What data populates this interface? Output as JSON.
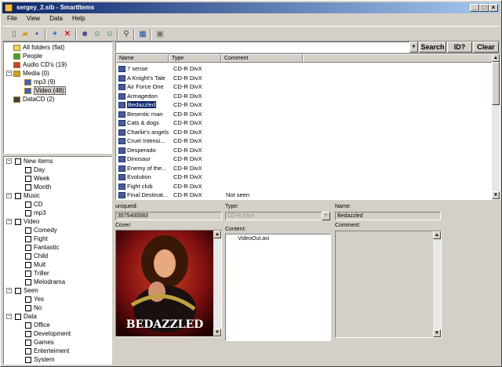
{
  "window": {
    "title": "sergey_2.sib - SmartItems"
  },
  "menu": [
    "File",
    "View",
    "Data",
    "Help"
  ],
  "folder_tree": [
    {
      "label": "All folders (flat)",
      "indent": 0
    },
    {
      "label": "People",
      "indent": 0
    },
    {
      "label": "Audio CD's  (19)",
      "indent": 0
    },
    {
      "label": "Media  (0)",
      "indent": 0
    },
    {
      "label": "mp3  (9)",
      "indent": 1
    },
    {
      "label": "Video  (48)",
      "indent": 1,
      "selected": true
    },
    {
      "label": "DataCD  (2)",
      "indent": 0
    }
  ],
  "filter_tree": [
    {
      "label": "New items",
      "indent": 0
    },
    {
      "label": "Day",
      "indent": 1
    },
    {
      "label": "Week",
      "indent": 1
    },
    {
      "label": "Month",
      "indent": 1
    },
    {
      "label": "Music",
      "indent": 0
    },
    {
      "label": "CD",
      "indent": 1
    },
    {
      "label": "mp3",
      "indent": 1
    },
    {
      "label": "Video",
      "indent": 0
    },
    {
      "label": "Comedy",
      "indent": 1
    },
    {
      "label": "Fight",
      "indent": 1
    },
    {
      "label": "Fantastic",
      "indent": 1
    },
    {
      "label": "Child",
      "indent": 1
    },
    {
      "label": "Mult",
      "indent": 1
    },
    {
      "label": "Triller",
      "indent": 1
    },
    {
      "label": "Melodrama",
      "indent": 1
    },
    {
      "label": "Seen",
      "indent": 0
    },
    {
      "label": "Yes",
      "indent": 1
    },
    {
      "label": "No",
      "indent": 1
    },
    {
      "label": "Data",
      "indent": 0
    },
    {
      "label": "Office",
      "indent": 1
    },
    {
      "label": "Development",
      "indent": 1
    },
    {
      "label": "Games",
      "indent": 1
    },
    {
      "label": "Enterteiment",
      "indent": 1
    },
    {
      "label": "System",
      "indent": 1
    }
  ],
  "search": {
    "value": "",
    "search_label": "Search",
    "id_label": "ID?",
    "clear_label": "Clear"
  },
  "list": {
    "headers": {
      "name": "Name",
      "type": "Type",
      "comment": "Comment"
    },
    "rows": [
      {
        "name": "7 sense",
        "type": "CD-R DivX",
        "comment": ""
      },
      {
        "name": "A Knight's Tale",
        "type": "CD-R DivX",
        "comment": ""
      },
      {
        "name": "Air Force One",
        "type": "CD-R DivX",
        "comment": ""
      },
      {
        "name": "Armagedon",
        "type": "CD-R DivX",
        "comment": ""
      },
      {
        "name": "Bedazzled",
        "type": "CD-R DivX",
        "comment": "",
        "selected": true
      },
      {
        "name": "Besentic man",
        "type": "CD-R DivX",
        "comment": ""
      },
      {
        "name": "Cats & dogs",
        "type": "CD-R DivX",
        "comment": ""
      },
      {
        "name": "Charlie's angels",
        "type": "CD-R DivX",
        "comment": ""
      },
      {
        "name": "Cruel Intensi...",
        "type": "CD-R DivX",
        "comment": ""
      },
      {
        "name": "Desperado",
        "type": "CD-R DivX",
        "comment": ""
      },
      {
        "name": "Dinosaur",
        "type": "CD-R DivX",
        "comment": ""
      },
      {
        "name": "Enemy of the...",
        "type": "CD-R DivX",
        "comment": ""
      },
      {
        "name": "Evolution",
        "type": "CD-R DivX",
        "comment": ""
      },
      {
        "name": "Fight club",
        "type": "CD-R DivX",
        "comment": ""
      },
      {
        "name": "Final Destinat...",
        "type": "CD-R DivX",
        "comment": "Not seen"
      }
    ]
  },
  "details": {
    "uniqueid_label": "uniqueid:",
    "uniqueid_value": "3575400583",
    "type_label": "Type:",
    "type_value": "CD-R DivX",
    "name_label": "Name:",
    "name_value": "Bedazzled",
    "cover_label": "Cover:",
    "content_label": "Content:",
    "comment_label": "Comment:",
    "cover_title": "BEDAZZLED",
    "content_items": [
      "VideoOut.avi"
    ]
  }
}
